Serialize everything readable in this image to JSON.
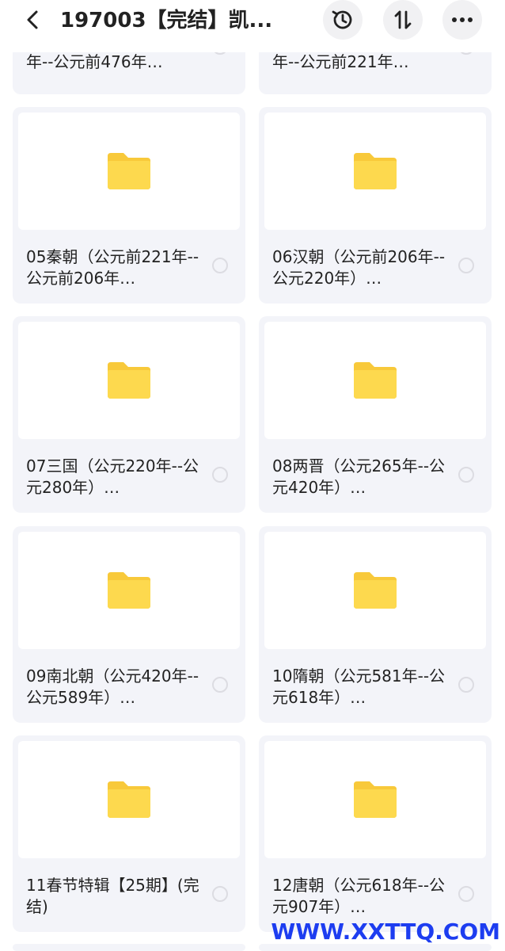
{
  "header": {
    "title": "197003【完结】凯..."
  },
  "icons": {
    "back": "chevron-left-icon",
    "history": "history-clock-icon",
    "sort": "sort-arrows-icon",
    "more": "more-dots-icon",
    "folder": "folder-icon"
  },
  "colors": {
    "folder": "#FDD94E",
    "folder_tab": "#F8C93A",
    "card_bg": "#F3F4F9",
    "text": "#222222",
    "watermark": "#1D3DF0"
  },
  "folders": [
    {
      "name": "年--公元前476年…"
    },
    {
      "name": "年--公元前221年…"
    },
    {
      "name": "05秦朝（公元前221年--公元前206年…"
    },
    {
      "name": "06汉朝（公元前206年--公元220年）…"
    },
    {
      "name": "07三国（公元220年--公元280年）…"
    },
    {
      "name": "08两晋（公元265年--公元420年）…"
    },
    {
      "name": "09南北朝（公元420年--公元589年）…"
    },
    {
      "name": "10隋朝（公元581年--公元618年）…"
    },
    {
      "name": "11春节特辑【25期】(完结)"
    },
    {
      "name": "12唐朝（公元618年--公元907年）…"
    }
  ],
  "watermark": "WWW.XXTTQ.COM"
}
